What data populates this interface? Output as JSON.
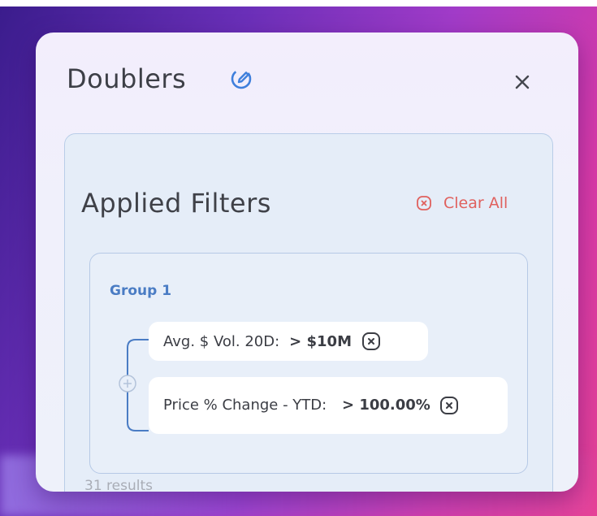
{
  "dialog": {
    "title": "Doublers",
    "edit_icon": "edit-icon",
    "close_icon": "close-icon"
  },
  "filters": {
    "title": "Applied Filters",
    "clear_all_label": "Clear All",
    "clear_all_icon": "clear-circle-icon"
  },
  "groups": [
    {
      "title": "Group 1",
      "add_icon": "plus-circle-icon",
      "conditions": [
        {
          "label": "Avg. $ Vol. 20D:",
          "value": "> $10M"
        },
        {
          "label": "Price % Change - YTD:",
          "value": "> 100.00%"
        }
      ]
    }
  ],
  "results": "31 results",
  "colors": {
    "accent_blue": "#4a7cc4",
    "clear_red": "#e0615e",
    "title_text": "#3d3f47"
  }
}
